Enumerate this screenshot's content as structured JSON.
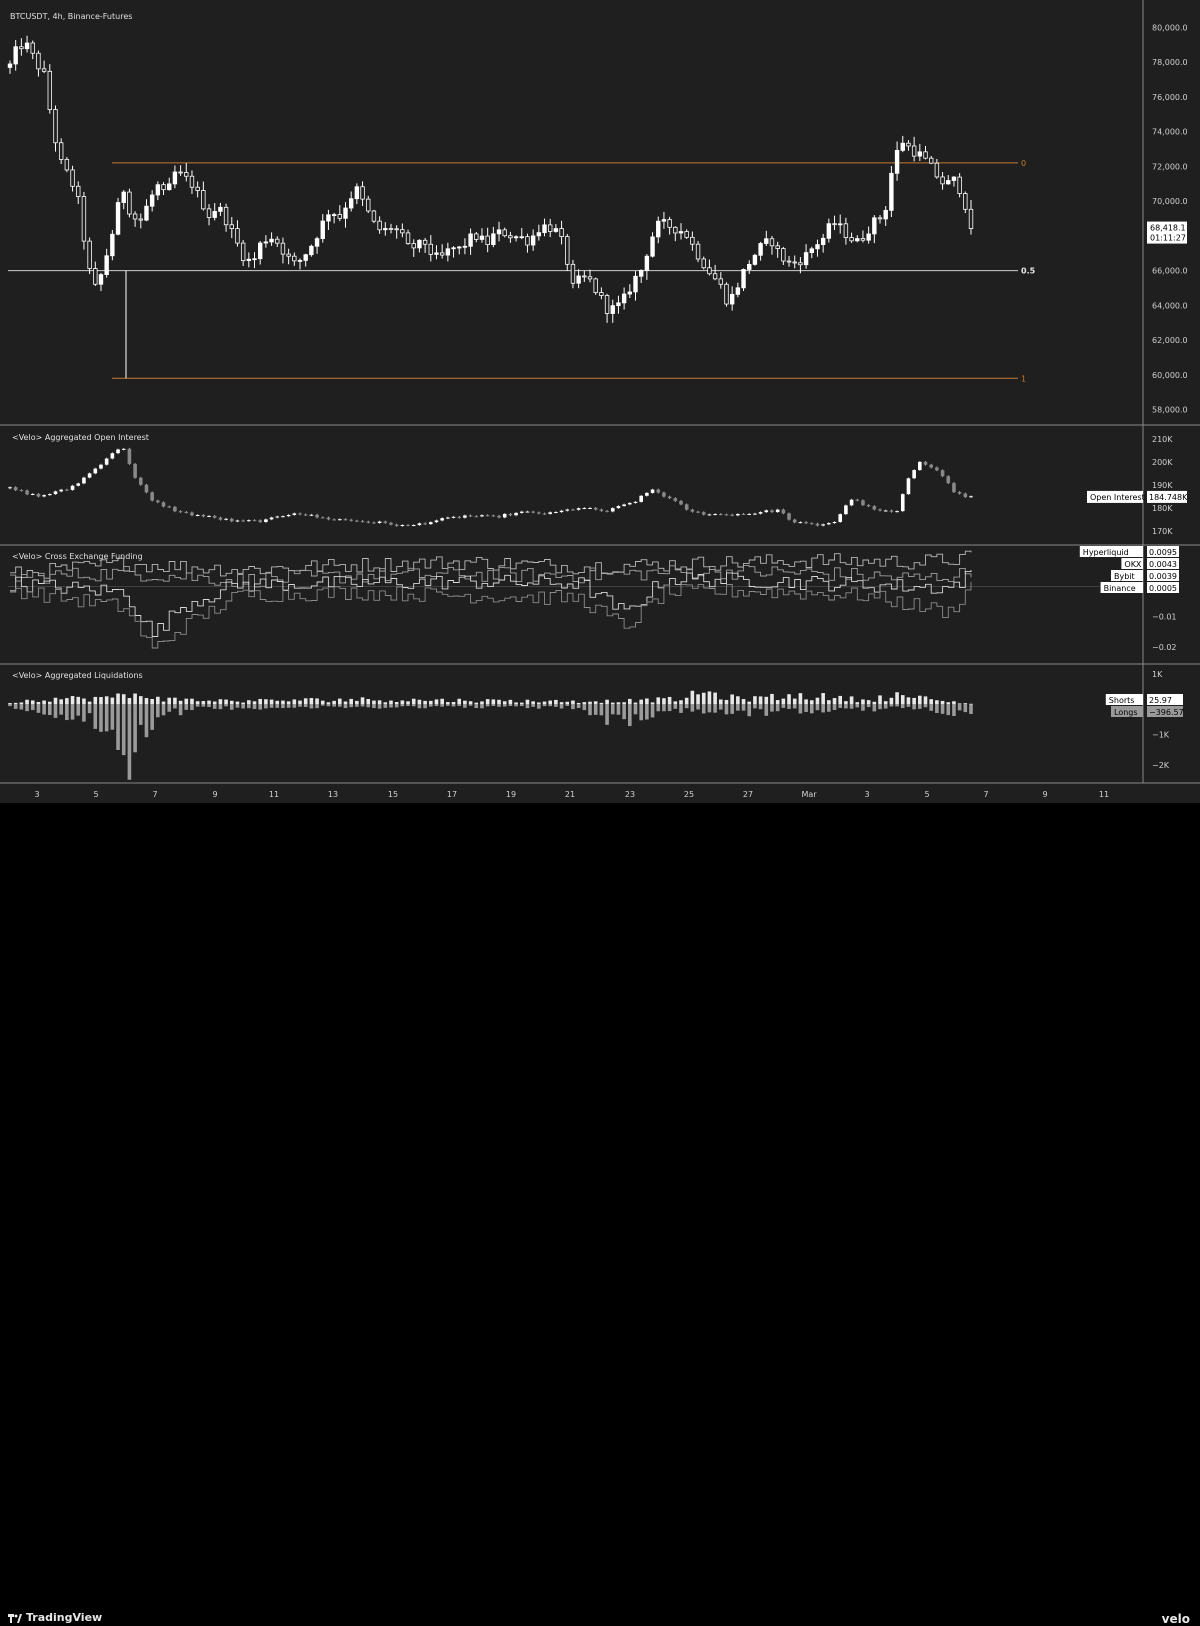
{
  "header": {
    "symbol_line": "BTCUSDT, 4h, Binance-Futures"
  },
  "footer": {
    "left_logo": "TradingView",
    "right_logo": "velo"
  },
  "colors": {
    "background": "#000000",
    "panel_bg": "#1f1f1f",
    "candle_up": "#ffffff",
    "candle_down": "#ffffff",
    "fib_orange": "#c87a30",
    "fib_half": "#cfcfcf"
  },
  "chart_data": [
    {
      "type": "candlestick",
      "title": "BTCUSDT, 4h, Binance-Futures",
      "x_ticks": [
        "3",
        "5",
        "7",
        "9",
        "11",
        "13",
        "15",
        "17",
        "19",
        "21",
        "23",
        "25",
        "27",
        "Mar",
        "3",
        "5",
        "7",
        "9",
        "11"
      ],
      "y_ticks": [
        "80,000.0",
        "78,000.0",
        "76,000.0",
        "74,000.0",
        "72,000.0",
        "70,000.0",
        "68,000.0",
        "66,000.0",
        "64,000.0",
        "62,000.0",
        "60,000.0",
        "58,000.0"
      ],
      "ylim": [
        57400,
        81000
      ],
      "last_price": "68,418.1",
      "countdown": "01:11:27",
      "fib_levels": [
        {
          "label": "0",
          "value": 72200,
          "color": "#c87a30"
        },
        {
          "label": "0.5",
          "value": 66000,
          "color": "#cfcfcf"
        },
        {
          "label": "1",
          "value": 59800,
          "color": "#c87a30"
        }
      ],
      "close_path": [
        [
          0,
          77800
        ],
        [
          1,
          79000
        ],
        [
          2,
          78900
        ],
        [
          3,
          78000
        ],
        [
          4,
          77200
        ],
        [
          5,
          74000
        ],
        [
          6,
          72000
        ],
        [
          7,
          71300
        ],
        [
          8,
          69800
        ],
        [
          9,
          66200
        ],
        [
          10,
          64800
        ],
        [
          11,
          66600
        ],
        [
          12,
          68500
        ],
        [
          13,
          70900
        ],
        [
          14,
          69200
        ],
        [
          15,
          68800
        ],
        [
          16,
          69900
        ],
        [
          17,
          70900
        ],
        [
          18,
          70200
        ],
        [
          19,
          71600
        ],
        [
          20,
          71400
        ],
        [
          21,
          71000
        ],
        [
          22,
          70100
        ],
        [
          23,
          69200
        ],
        [
          24,
          69700
        ],
        [
          25,
          68900
        ],
        [
          26,
          67800
        ],
        [
          27,
          66800
        ],
        [
          28,
          66400
        ],
        [
          29,
          67600
        ],
        [
          30,
          68000
        ],
        [
          31,
          67600
        ],
        [
          32,
          66800
        ],
        [
          33,
          66300
        ],
        [
          34,
          66900
        ],
        [
          35,
          67600
        ],
        [
          36,
          68600
        ],
        [
          37,
          69600
        ],
        [
          38,
          69000
        ],
        [
          39,
          70000
        ],
        [
          40,
          70700
        ],
        [
          41,
          69700
        ],
        [
          42,
          68700
        ],
        [
          43,
          68200
        ],
        [
          44,
          68500
        ],
        [
          45,
          68200
        ],
        [
          46,
          67300
        ],
        [
          47,
          67400
        ],
        [
          48,
          67600
        ],
        [
          49,
          66700
        ],
        [
          50,
          66800
        ],
        [
          51,
          67300
        ],
        [
          52,
          67200
        ],
        [
          53,
          67800
        ],
        [
          54,
          68000
        ],
        [
          55,
          67500
        ],
        [
          56,
          68100
        ],
        [
          57,
          68200
        ],
        [
          58,
          68000
        ],
        [
          59,
          67900
        ],
        [
          60,
          67700
        ],
        [
          61,
          68400
        ],
        [
          62,
          68600
        ],
        [
          63,
          68300
        ],
        [
          64,
          67400
        ],
        [
          65,
          65000
        ],
        [
          66,
          65600
        ],
        [
          67,
          65400
        ],
        [
          68,
          64600
        ],
        [
          69,
          63800
        ],
        [
          70,
          63800
        ],
        [
          71,
          64400
        ],
        [
          72,
          65400
        ],
        [
          73,
          66100
        ],
        [
          74,
          67800
        ],
        [
          75,
          68700
        ],
        [
          76,
          68600
        ],
        [
          77,
          68400
        ],
        [
          78,
          68200
        ],
        [
          79,
          67300
        ],
        [
          80,
          66500
        ],
        [
          81,
          65800
        ],
        [
          82,
          65200
        ],
        [
          83,
          64100
        ],
        [
          84,
          65100
        ],
        [
          85,
          66200
        ],
        [
          86,
          66900
        ],
        [
          87,
          67500
        ],
        [
          88,
          67700
        ],
        [
          89,
          66800
        ],
        [
          90,
          66400
        ],
        [
          91,
          66500
        ],
        [
          92,
          66900
        ],
        [
          93,
          67500
        ],
        [
          94,
          67900
        ],
        [
          95,
          68800
        ],
        [
          96,
          68400
        ],
        [
          97,
          67900
        ],
        [
          98,
          67600
        ],
        [
          99,
          68300
        ],
        [
          100,
          68900
        ],
        [
          101,
          69200
        ],
        [
          102,
          72200
        ],
        [
          103,
          73500
        ],
        [
          104,
          73000
        ],
        [
          105,
          72700
        ],
        [
          106,
          72200
        ],
        [
          107,
          71500
        ],
        [
          108,
          70900
        ],
        [
          109,
          71200
        ],
        [
          110,
          70500
        ],
        [
          111,
          68418
        ]
      ]
    },
    {
      "type": "bar",
      "title": "<Velo> Aggregated Open Interest",
      "y_ticks": [
        "210K",
        "200K",
        "190K",
        "180K",
        "170K"
      ],
      "ylim": [
        166000,
        213000
      ],
      "readout_label": "Open Interest",
      "readout_value": "184.748K",
      "path": [
        [
          0,
          188500
        ],
        [
          5,
          185000
        ],
        [
          10,
          188000
        ],
        [
          12,
          191000
        ],
        [
          15,
          197000
        ],
        [
          18,
          204000
        ],
        [
          20,
          206000
        ],
        [
          22,
          193000
        ],
        [
          25,
          183000
        ],
        [
          30,
          178000
        ],
        [
          35,
          176000
        ],
        [
          40,
          174000
        ],
        [
          45,
          174500
        ],
        [
          50,
          178000
        ],
        [
          55,
          175500
        ],
        [
          60,
          174500
        ],
        [
          65,
          173500
        ],
        [
          70,
          172000
        ],
        [
          75,
          174500
        ],
        [
          80,
          176500
        ],
        [
          85,
          176000
        ],
        [
          90,
          178000
        ],
        [
          95,
          177500
        ],
        [
          100,
          180000
        ],
        [
          105,
          178500
        ],
        [
          110,
          183000
        ],
        [
          113,
          188000
        ],
        [
          116,
          184000
        ],
        [
          120,
          178000
        ],
        [
          125,
          177000
        ],
        [
          130,
          177500
        ],
        [
          135,
          179000
        ],
        [
          138,
          173500
        ],
        [
          142,
          172500
        ],
        [
          145,
          174000
        ],
        [
          148,
          184000
        ],
        [
          152,
          179000
        ],
        [
          156,
          178000
        ],
        [
          158,
          193000
        ],
        [
          160,
          200500
        ],
        [
          162,
          198000
        ],
        [
          164,
          194000
        ],
        [
          166,
          187000
        ],
        [
          168,
          185000
        ],
        [
          169,
          184748
        ]
      ]
    },
    {
      "type": "line",
      "title": "<Velo> Cross Exchange Funding",
      "y_ticks": [
        "−0.01",
        "−0.02"
      ],
      "ylim": [
        -0.025,
        0.012
      ],
      "readouts": [
        {
          "label": "Hyperliquid",
          "value": "0.0095"
        },
        {
          "label": "OKX",
          "value": "0.0043"
        },
        {
          "label": "Bybit",
          "value": "0.0039"
        },
        {
          "label": "Binance",
          "value": "0.0005"
        }
      ],
      "series": [
        {
          "name": "Hyperliquid",
          "path": [
            [
              0,
              0.004
            ],
            [
              20,
              0.0075
            ],
            [
              40,
              0.0055
            ],
            [
              60,
              0.007
            ],
            [
              80,
              0.008
            ],
            [
              100,
              0.0065
            ],
            [
              120,
              0.0075
            ],
            [
              140,
              0.0085
            ],
            [
              160,
              0.008
            ],
            [
              169,
              0.0095
            ]
          ]
        },
        {
          "name": "OKX",
          "path": [
            [
              0,
              0.003
            ],
            [
              20,
              0.0045
            ],
            [
              40,
              0.002
            ],
            [
              60,
              0.0035
            ],
            [
              80,
              0.004
            ],
            [
              100,
              0.0035
            ],
            [
              120,
              0.005
            ],
            [
              140,
              0.0045
            ],
            [
              160,
              0.0025
            ],
            [
              169,
              0.0043
            ]
          ]
        },
        {
          "name": "Bybit",
          "path": [
            [
              0,
              0.001
            ],
            [
              20,
              -0.002
            ],
            [
              25,
              -0.016
            ],
            [
              30,
              -0.0065
            ],
            [
              40,
              0.0005
            ],
            [
              60,
              0.001
            ],
            [
              80,
              0.0015
            ],
            [
              100,
              0.001
            ],
            [
              108,
              -0.009
            ],
            [
              115,
              0.0025
            ],
            [
              130,
              0.002
            ],
            [
              150,
              0.0005
            ],
            [
              165,
              -0.0005
            ],
            [
              169,
              0.0039
            ]
          ]
        },
        {
          "name": "Binance",
          "path": [
            [
              0,
              -0.001
            ],
            [
              20,
              -0.007
            ],
            [
              25,
              -0.021
            ],
            [
              30,
              -0.0135
            ],
            [
              40,
              -0.003
            ],
            [
              60,
              -0.002
            ],
            [
              80,
              -0.003
            ],
            [
              100,
              -0.004
            ],
            [
              108,
              -0.0135
            ],
            [
              115,
              -0.002
            ],
            [
              130,
              -0.0015
            ],
            [
              150,
              -0.003
            ],
            [
              165,
              -0.0085
            ],
            [
              169,
              0.0005
            ]
          ]
        }
      ]
    },
    {
      "type": "bar",
      "title": "<Velo> Aggregated Liquidations",
      "y_ticks": [
        "1K",
        "−1K",
        "−2K"
      ],
      "ylim": [
        -2500,
        1200
      ],
      "readouts": [
        {
          "label": "Shorts",
          "value": "25.97"
        },
        {
          "label": "Longs",
          "value": "−396.57"
        }
      ],
      "shorts_path": [
        [
          0,
          60
        ],
        [
          5,
          220
        ],
        [
          15,
          250
        ],
        [
          20,
          320
        ],
        [
          24,
          380
        ],
        [
          28,
          200
        ],
        [
          40,
          140
        ],
        [
          60,
          200
        ],
        [
          80,
          160
        ],
        [
          100,
          120
        ],
        [
          110,
          150
        ],
        [
          118,
          220
        ],
        [
          122,
          500
        ],
        [
          128,
          220
        ],
        [
          140,
          360
        ],
        [
          150,
          180
        ],
        [
          157,
          380
        ],
        [
          162,
          180
        ],
        [
          169,
          25.97
        ]
      ],
      "longs_path": [
        [
          0,
          -80
        ],
        [
          8,
          -400
        ],
        [
          14,
          -620
        ],
        [
          20,
          -1600
        ],
        [
          21,
          -2350
        ],
        [
          22,
          -1450
        ],
        [
          26,
          -420
        ],
        [
          35,
          -150
        ],
        [
          60,
          -120
        ],
        [
          80,
          -100
        ],
        [
          100,
          -140
        ],
        [
          108,
          -820
        ],
        [
          115,
          -230
        ],
        [
          130,
          -330
        ],
        [
          150,
          -210
        ],
        [
          160,
          -160
        ],
        [
          169,
          -396.57
        ]
      ]
    }
  ]
}
